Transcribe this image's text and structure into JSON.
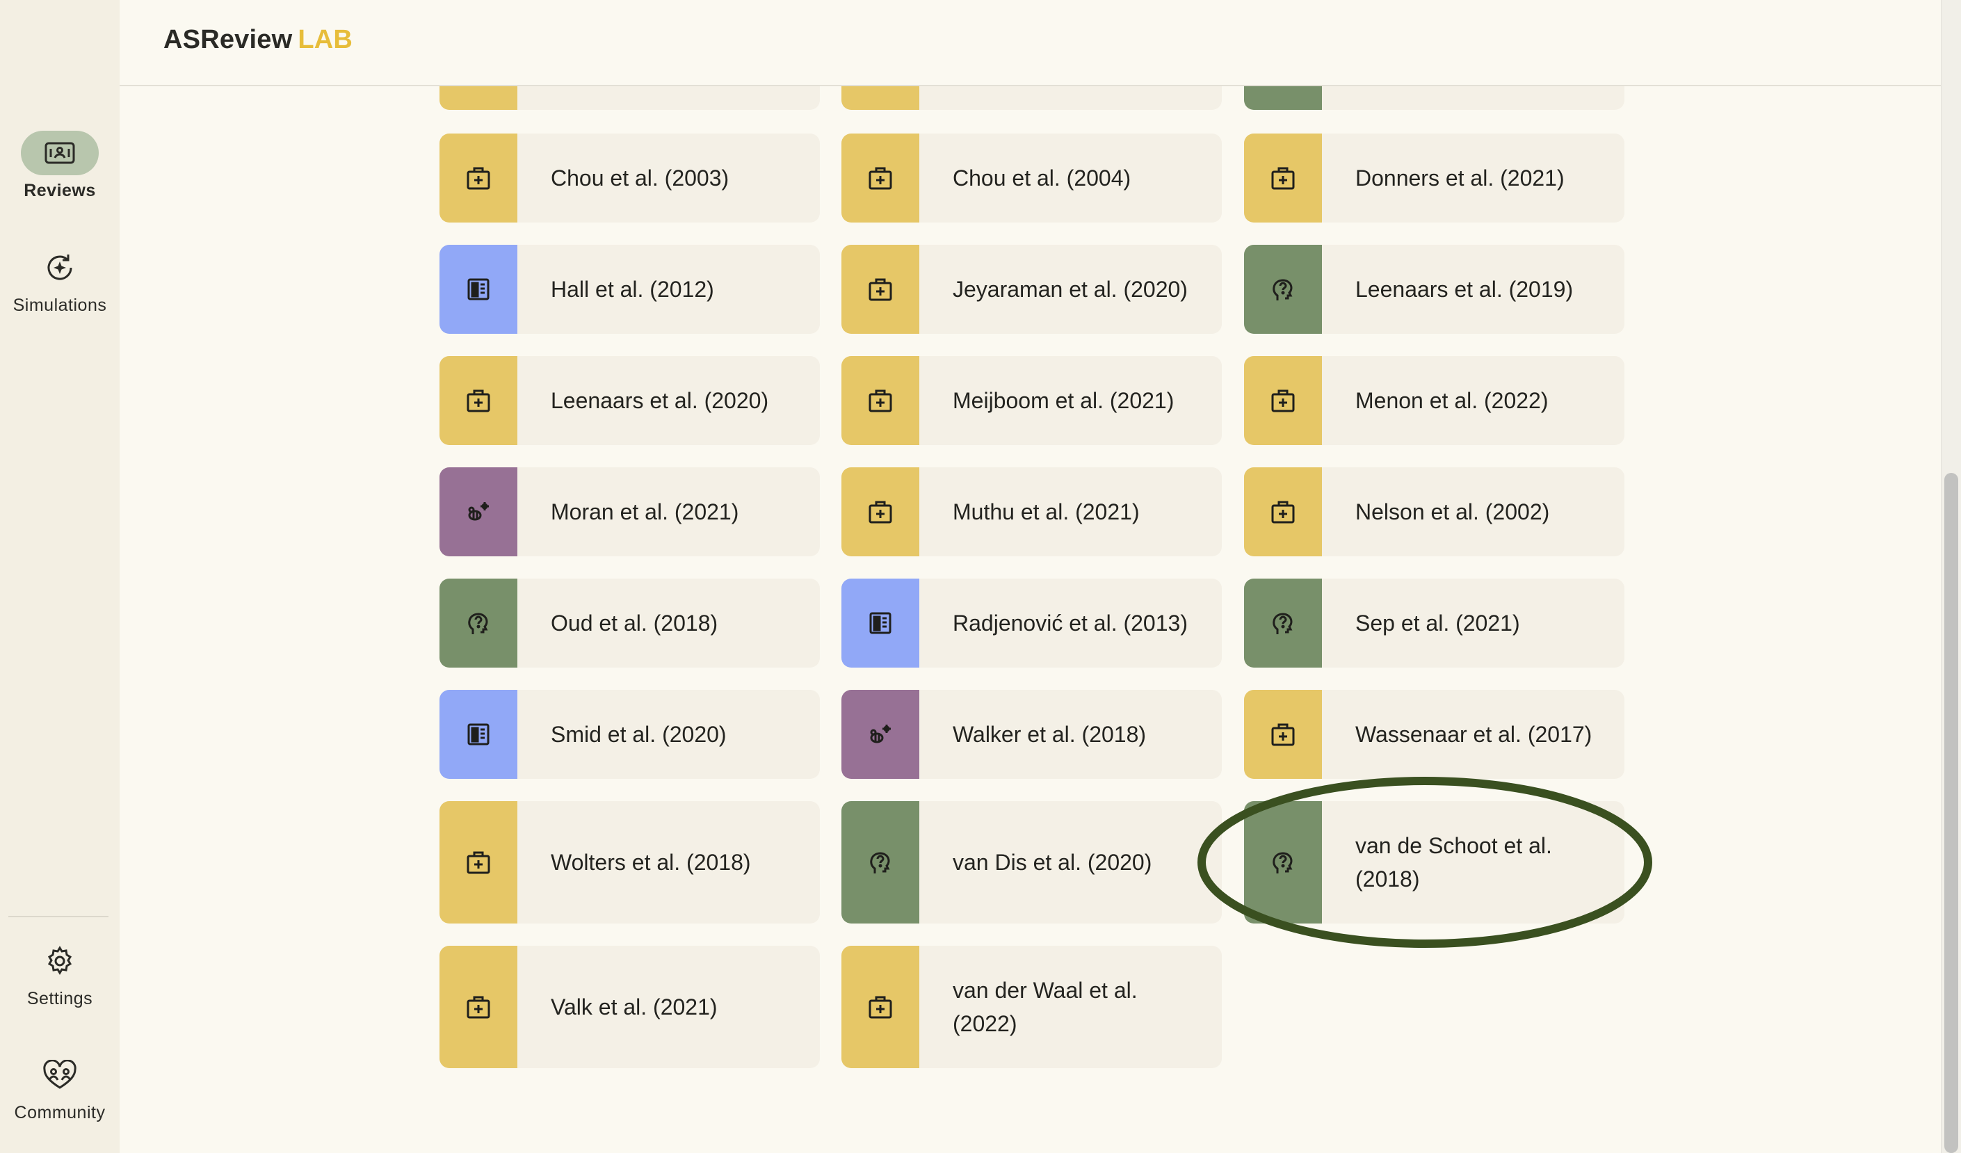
{
  "app": {
    "brand": "ASReview",
    "brand_suffix": "LAB"
  },
  "sidebar": {
    "items": [
      {
        "label": "Reviews",
        "icon": "reviews-icon",
        "active": true
      },
      {
        "label": "Simulations",
        "icon": "simulations-icon",
        "active": false
      },
      {
        "label": "Settings",
        "icon": "gear-icon",
        "active": false
      },
      {
        "label": "Community",
        "icon": "community-icon",
        "active": false
      }
    ]
  },
  "datasets": [
    {
      "label": "",
      "category": "medicine",
      "color": "#e6c767",
      "icon": "medical-kit-icon"
    },
    {
      "label": "",
      "category": "medicine",
      "color": "#e6c767",
      "icon": "medical-kit-icon"
    },
    {
      "label": "",
      "category": "psychology",
      "color": "#78906a",
      "icon": "head-question-icon"
    },
    {
      "label": "Chou et al. (2003)",
      "category": "medicine",
      "color": "#e6c767",
      "icon": "medical-kit-icon"
    },
    {
      "label": "Chou et al. (2004)",
      "category": "medicine",
      "color": "#e6c767",
      "icon": "medical-kit-icon"
    },
    {
      "label": "Donners et al. (2021)",
      "category": "medicine",
      "color": "#e6c767",
      "icon": "medical-kit-icon"
    },
    {
      "label": "Hall et al. (2012)",
      "category": "computer-science",
      "color": "#91a8f7",
      "icon": "chip-icon"
    },
    {
      "label": "Jeyaraman et al. (2020)",
      "category": "medicine",
      "color": "#e6c767",
      "icon": "medical-kit-icon"
    },
    {
      "label": "Leenaars et al. (2019)",
      "category": "psychology",
      "color": "#78906a",
      "icon": "head-question-icon"
    },
    {
      "label": "Leenaars et al. (2020)",
      "category": "medicine",
      "color": "#e6c767",
      "icon": "medical-kit-icon"
    },
    {
      "label": "Meijboom et al. (2021)",
      "category": "medicine",
      "color": "#e6c767",
      "icon": "medical-kit-icon"
    },
    {
      "label": "Menon et al. (2022)",
      "category": "medicine",
      "color": "#e6c767",
      "icon": "medical-kit-icon"
    },
    {
      "label": "Moran et al. (2021)",
      "category": "biology",
      "color": "#977195",
      "icon": "bee-icon"
    },
    {
      "label": "Muthu et al. (2021)",
      "category": "medicine",
      "color": "#e6c767",
      "icon": "medical-kit-icon"
    },
    {
      "label": "Nelson et al. (2002)",
      "category": "medicine",
      "color": "#e6c767",
      "icon": "medical-kit-icon"
    },
    {
      "label": "Oud et al. (2018)",
      "category": "psychology",
      "color": "#78906a",
      "icon": "head-question-icon"
    },
    {
      "label": "Radjenović et al. (2013)",
      "category": "computer-science",
      "color": "#91a8f7",
      "icon": "chip-icon"
    },
    {
      "label": "Sep et al. (2021)",
      "category": "psychology",
      "color": "#78906a",
      "icon": "head-question-icon"
    },
    {
      "label": "Smid et al. (2020)",
      "category": "computer-science",
      "color": "#91a8f7",
      "icon": "chip-icon"
    },
    {
      "label": "Walker et al. (2018)",
      "category": "biology",
      "color": "#977195",
      "icon": "bee-icon"
    },
    {
      "label": "Wassenaar et al. (2017)",
      "category": "medicine",
      "color": "#e6c767",
      "icon": "medical-kit-icon"
    },
    {
      "label": "Wolters et al. (2018)",
      "category": "medicine",
      "color": "#e6c767",
      "icon": "medical-kit-icon"
    },
    {
      "label": "van Dis et al. (2020)",
      "category": "psychology",
      "color": "#78906a",
      "icon": "head-question-icon"
    },
    {
      "label": "van de Schoot et al. (2018)",
      "category": "psychology",
      "color": "#78906a",
      "icon": "head-question-icon",
      "highlighted": true
    },
    {
      "label": "Valk et al. (2021)",
      "category": "medicine",
      "color": "#e6c767",
      "icon": "medical-kit-icon"
    },
    {
      "label": "van der Waal et al. (2022)",
      "category": "medicine",
      "color": "#e6c767",
      "icon": "medical-kit-icon"
    }
  ],
  "colors": {
    "medicine": "#e6c767",
    "computer_science": "#91a8f7",
    "psychology": "#78906a",
    "biology": "#977195",
    "highlight_ring": "#3a5020",
    "accent": "#e7bd3a"
  }
}
